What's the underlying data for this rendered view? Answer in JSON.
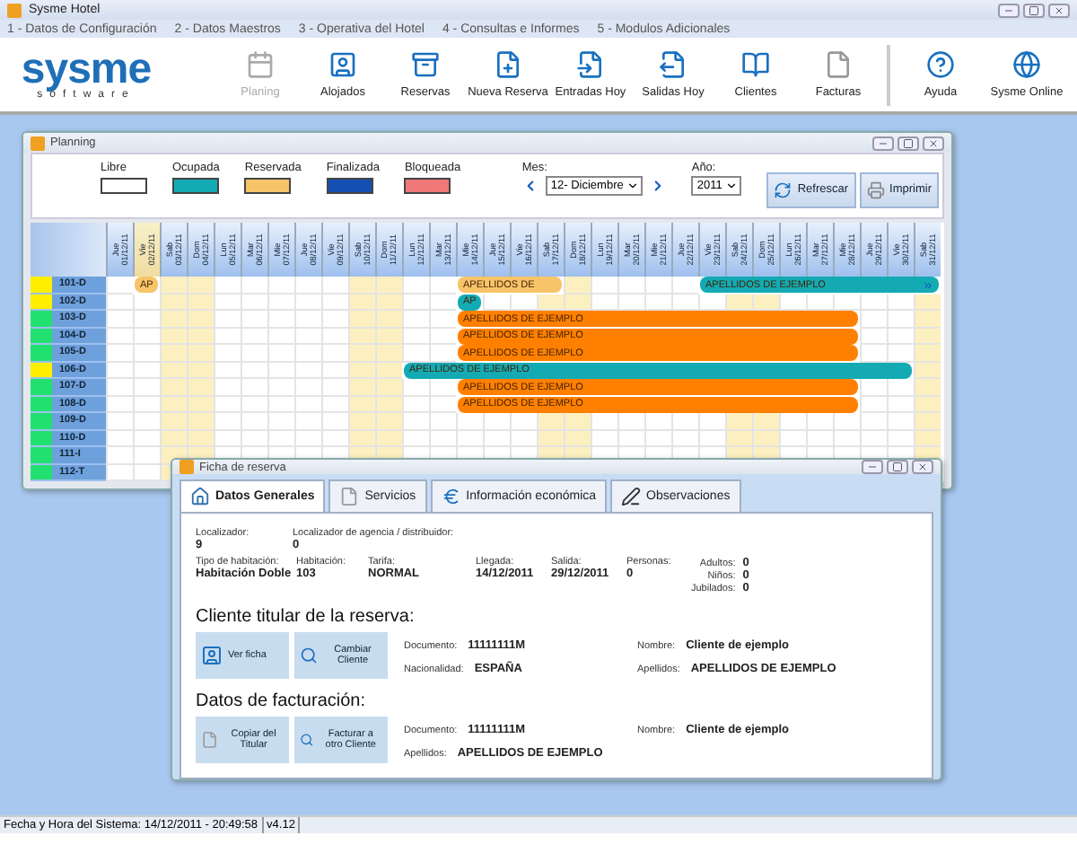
{
  "window": {
    "title": "Sysme Hotel"
  },
  "menu": [
    "1 - Datos de Configuración",
    "2 - Datos Maestros",
    "3 - Operativa del Hotel",
    "4 - Consultas e Informes",
    "5 - Modulos Adicionales"
  ],
  "logo": {
    "name": "sysme",
    "tagline": "software"
  },
  "toolbar": [
    {
      "label": "Planing",
      "kind": "calendar",
      "disabled": true
    },
    {
      "label": "Alojados",
      "kind": "guest",
      "disabled": false
    },
    {
      "label": "Reservas",
      "kind": "cabinet",
      "disabled": false
    },
    {
      "label": "Nueva Reserva",
      "kind": "newdoc",
      "disabled": false
    },
    {
      "label": "Entradas Hoy",
      "kind": "docin",
      "disabled": false
    },
    {
      "label": "Salidas Hoy",
      "kind": "docout",
      "disabled": false
    },
    {
      "label": "Clientes",
      "kind": "book",
      "disabled": false
    },
    {
      "label": "Facturas",
      "kind": "doc",
      "disabled": false
    },
    {
      "label": "Ayuda",
      "kind": "help",
      "disabled": false
    },
    {
      "label": "Sysme Online",
      "kind": "globe",
      "disabled": false
    }
  ],
  "planning": {
    "title": "Planning",
    "legend": [
      {
        "label": "Libre",
        "color": "#ffffff"
      },
      {
        "label": "Ocupada",
        "color": "#14aab4"
      },
      {
        "label": "Reservada",
        "color": "#f8c46a"
      },
      {
        "label": "Finalizada",
        "color": "#1450b4"
      },
      {
        "label": "Bloqueada",
        "color": "#f07878"
      }
    ],
    "month_label": "Mes:",
    "month": "12- Diciembre",
    "year_label": "Año:",
    "year": "2011",
    "buttons": [
      "Refrescar",
      "Imprimir"
    ],
    "days": [
      {
        "day": "Jue",
        "date": "01/12/11",
        "weekend": false,
        "selected": false
      },
      {
        "day": "Vie",
        "date": "02/12/11",
        "weekend": false,
        "selected": true
      },
      {
        "day": "Sab",
        "date": "03/12/11",
        "weekend": true,
        "selected": false
      },
      {
        "day": "Dom",
        "date": "04/12/11",
        "weekend": true,
        "selected": false
      },
      {
        "day": "Lun",
        "date": "05/12/11",
        "weekend": false,
        "selected": false
      },
      {
        "day": "Mar",
        "date": "06/12/11",
        "weekend": false,
        "selected": false
      },
      {
        "day": "Mie",
        "date": "07/12/11",
        "weekend": false,
        "selected": false
      },
      {
        "day": "Jue",
        "date": "08/12/11",
        "weekend": false,
        "selected": false
      },
      {
        "day": "Vie",
        "date": "09/12/11",
        "weekend": false,
        "selected": false
      },
      {
        "day": "Sab",
        "date": "10/12/11",
        "weekend": true,
        "selected": false
      },
      {
        "day": "Dom",
        "date": "11/12/11",
        "weekend": true,
        "selected": false
      },
      {
        "day": "Lun",
        "date": "12/12/11",
        "weekend": false,
        "selected": false
      },
      {
        "day": "Mar",
        "date": "13/12/11",
        "weekend": false,
        "selected": false
      },
      {
        "day": "Mie",
        "date": "14/12/11",
        "weekend": false,
        "selected": false
      },
      {
        "day": "Jue",
        "date": "15/12/11",
        "weekend": false,
        "selected": false
      },
      {
        "day": "Vie",
        "date": "16/12/11",
        "weekend": false,
        "selected": false
      },
      {
        "day": "Sab",
        "date": "17/12/11",
        "weekend": true,
        "selected": false
      },
      {
        "day": "Dom",
        "date": "18/12/11",
        "weekend": true,
        "selected": false
      },
      {
        "day": "Lun",
        "date": "19/12/11",
        "weekend": false,
        "selected": false
      },
      {
        "day": "Mar",
        "date": "20/12/11",
        "weekend": false,
        "selected": false
      },
      {
        "day": "Mie",
        "date": "21/12/11",
        "weekend": false,
        "selected": false
      },
      {
        "day": "Jue",
        "date": "22/12/11",
        "weekend": false,
        "selected": false
      },
      {
        "day": "Vie",
        "date": "23/12/11",
        "weekend": false,
        "selected": false
      },
      {
        "day": "Sab",
        "date": "24/12/11",
        "weekend": true,
        "selected": false
      },
      {
        "day": "Dom",
        "date": "25/12/11",
        "weekend": true,
        "selected": false
      },
      {
        "day": "Lun",
        "date": "26/12/11",
        "weekend": false,
        "selected": false
      },
      {
        "day": "Mar",
        "date": "27/12/11",
        "weekend": false,
        "selected": false
      },
      {
        "day": "Mie",
        "date": "28/12/11",
        "weekend": false,
        "selected": false
      },
      {
        "day": "Jue",
        "date": "29/12/11",
        "weekend": false,
        "selected": false
      },
      {
        "day": "Vie",
        "date": "30/12/11",
        "weekend": false,
        "selected": false
      },
      {
        "day": "Sab",
        "date": "31/12/11",
        "weekend": true,
        "selected": false
      }
    ],
    "rooms": [
      {
        "name": "101-D",
        "color": "#ffee00",
        "cells": [
          {
            "kind": "free"
          },
          {
            "kind": "booking",
            "label": "AP",
            "color": "#f8c46a"
          },
          {
            "kind": "free"
          },
          {
            "kind": "free"
          },
          {
            "kind": "free"
          },
          {
            "kind": "free"
          },
          {
            "kind": "free"
          },
          {
            "kind": "free"
          },
          {
            "kind": "free"
          },
          {
            "kind": "free"
          },
          {
            "kind": "free"
          },
          {
            "kind": "free"
          },
          {
            "kind": "free"
          },
          {
            "kind": "booking",
            "label": "APELLIDOS DE",
            "color": "#f8c46a"
          },
          {
            "kind": "stay"
          },
          {
            "kind": "stay"
          },
          {
            "kind": "stay"
          },
          {
            "kind": "free"
          },
          {
            "kind": "free"
          },
          {
            "kind": "free"
          },
          {
            "kind": "free"
          },
          {
            "kind": "free"
          },
          {
            "kind": "booking",
            "label": "APELLIDOS DE EJEMPLO",
            "color": "#14aab4",
            "continues": true
          },
          {
            "kind": "stay"
          },
          {
            "kind": "stay"
          },
          {
            "kind": "stay"
          },
          {
            "kind": "stay"
          },
          {
            "kind": "stay"
          },
          {
            "kind": "stay"
          },
          {
            "kind": "stay"
          },
          {
            "kind": "stay"
          }
        ]
      },
      {
        "name": "102-D",
        "color": "#ffee00",
        "cells": [
          {
            "kind": "free"
          },
          {
            "kind": "free"
          },
          {
            "kind": "free"
          },
          {
            "kind": "free"
          },
          {
            "kind": "free"
          },
          {
            "kind": "free"
          },
          {
            "kind": "free"
          },
          {
            "kind": "free"
          },
          {
            "kind": "free"
          },
          {
            "kind": "free"
          },
          {
            "kind": "free"
          },
          {
            "kind": "free"
          },
          {
            "kind": "free"
          },
          {
            "kind": "booking",
            "label": "AP",
            "color": "#14aab4"
          }
        ]
      },
      {
        "name": "103-D",
        "color": "#22e070",
        "cells": [
          {
            "kind": "free"
          },
          {
            "kind": "free"
          },
          {
            "kind": "free"
          },
          {
            "kind": "free"
          },
          {
            "kind": "free"
          },
          {
            "kind": "free"
          },
          {
            "kind": "free"
          },
          {
            "kind": "free"
          },
          {
            "kind": "free"
          },
          {
            "kind": "free"
          },
          {
            "kind": "free"
          },
          {
            "kind": "free"
          },
          {
            "kind": "free"
          },
          {
            "kind": "booking",
            "label": "APELLIDOS DE EJEMPLO",
            "color": "#ff8000"
          },
          {
            "kind": "stay"
          },
          {
            "kind": "stay"
          },
          {
            "kind": "stay"
          },
          {
            "kind": "stay"
          },
          {
            "kind": "stay"
          },
          {
            "kind": "stay"
          },
          {
            "kind": "stay"
          },
          {
            "kind": "stay"
          },
          {
            "kind": "stay"
          },
          {
            "kind": "stay"
          },
          {
            "kind": "stay"
          },
          {
            "kind": "stay"
          },
          {
            "kind": "stay"
          },
          {
            "kind": "stay"
          }
        ]
      },
      {
        "name": "104-D",
        "color": "#22e070",
        "cells": [
          {
            "kind": "free"
          },
          {
            "kind": "free"
          },
          {
            "kind": "free"
          },
          {
            "kind": "free"
          },
          {
            "kind": "free"
          },
          {
            "kind": "free"
          },
          {
            "kind": "free"
          },
          {
            "kind": "free"
          },
          {
            "kind": "free"
          },
          {
            "kind": "free"
          },
          {
            "kind": "free"
          },
          {
            "kind": "free"
          },
          {
            "kind": "free"
          },
          {
            "kind": "booking",
            "label": "APELLIDOS DE EJEMPLO",
            "color": "#ff8000"
          },
          {
            "kind": "stay"
          },
          {
            "kind": "stay"
          },
          {
            "kind": "stay"
          },
          {
            "kind": "stay"
          },
          {
            "kind": "stay"
          },
          {
            "kind": "stay"
          },
          {
            "kind": "stay"
          },
          {
            "kind": "stay"
          },
          {
            "kind": "stay"
          },
          {
            "kind": "stay"
          },
          {
            "kind": "stay"
          },
          {
            "kind": "stay"
          },
          {
            "kind": "stay"
          },
          {
            "kind": "stay"
          }
        ]
      },
      {
        "name": "105-D",
        "color": "#22e070",
        "cells": [
          {
            "kind": "free"
          },
          {
            "kind": "free"
          },
          {
            "kind": "free"
          },
          {
            "kind": "free"
          },
          {
            "kind": "free"
          },
          {
            "kind": "free"
          },
          {
            "kind": "free"
          },
          {
            "kind": "free"
          },
          {
            "kind": "free"
          },
          {
            "kind": "free"
          },
          {
            "kind": "free"
          },
          {
            "kind": "free"
          },
          {
            "kind": "free"
          },
          {
            "kind": "booking",
            "label": "APELLIDOS DE EJEMPLO",
            "color": "#ff8000"
          },
          {
            "kind": "stay"
          },
          {
            "kind": "stay"
          },
          {
            "kind": "stay"
          },
          {
            "kind": "stay"
          },
          {
            "kind": "stay"
          },
          {
            "kind": "stay"
          },
          {
            "kind": "stay"
          },
          {
            "kind": "stay"
          },
          {
            "kind": "stay"
          },
          {
            "kind": "stay"
          },
          {
            "kind": "stay"
          },
          {
            "kind": "stay"
          },
          {
            "kind": "stay"
          },
          {
            "kind": "stay"
          }
        ]
      },
      {
        "name": "106-D",
        "color": "#ffee00",
        "cells": [
          {
            "kind": "free"
          },
          {
            "kind": "free"
          },
          {
            "kind": "free"
          },
          {
            "kind": "free"
          },
          {
            "kind": "free"
          },
          {
            "kind": "free"
          },
          {
            "kind": "free"
          },
          {
            "kind": "free"
          },
          {
            "kind": "free"
          },
          {
            "kind": "free"
          },
          {
            "kind": "free"
          },
          {
            "kind": "booking",
            "label": "APELLIDOS DE EJEMPLO",
            "color": "#14aab4"
          },
          {
            "kind": "stay"
          },
          {
            "kind": "stay"
          },
          {
            "kind": "stay"
          },
          {
            "kind": "stay"
          },
          {
            "kind": "stay"
          },
          {
            "kind": "stay"
          },
          {
            "kind": "stay"
          },
          {
            "kind": "stay"
          },
          {
            "kind": "stay"
          },
          {
            "kind": "stay"
          },
          {
            "kind": "stay"
          },
          {
            "kind": "stay"
          },
          {
            "kind": "stay"
          },
          {
            "kind": "stay"
          },
          {
            "kind": "stay"
          },
          {
            "kind": "stay"
          },
          {
            "kind": "stay"
          },
          {
            "kind": "stay"
          }
        ]
      },
      {
        "name": "107-D",
        "color": "#22e070",
        "cells": [
          {
            "kind": "free"
          },
          {
            "kind": "free"
          },
          {
            "kind": "free"
          },
          {
            "kind": "free"
          },
          {
            "kind": "free"
          },
          {
            "kind": "free"
          },
          {
            "kind": "free"
          },
          {
            "kind": "free"
          },
          {
            "kind": "free"
          },
          {
            "kind": "free"
          },
          {
            "kind": "free"
          },
          {
            "kind": "free"
          },
          {
            "kind": "free"
          },
          {
            "kind": "booking",
            "label": "APELLIDOS DE EJEMPLO",
            "color": "#ff8000"
          },
          {
            "kind": "stay"
          },
          {
            "kind": "stay"
          },
          {
            "kind": "stay"
          },
          {
            "kind": "stay"
          },
          {
            "kind": "stay"
          },
          {
            "kind": "stay"
          },
          {
            "kind": "stay"
          },
          {
            "kind": "stay"
          },
          {
            "kind": "stay"
          },
          {
            "kind": "stay"
          },
          {
            "kind": "stay"
          },
          {
            "kind": "stay"
          },
          {
            "kind": "stay"
          },
          {
            "kind": "stay"
          }
        ]
      },
      {
        "name": "108-D",
        "color": "#22e070",
        "cells": [
          {
            "kind": "free"
          },
          {
            "kind": "free"
          },
          {
            "kind": "free"
          },
          {
            "kind": "free"
          },
          {
            "kind": "free"
          },
          {
            "kind": "free"
          },
          {
            "kind": "free"
          },
          {
            "kind": "free"
          },
          {
            "kind": "free"
          },
          {
            "kind": "free"
          },
          {
            "kind": "free"
          },
          {
            "kind": "free"
          },
          {
            "kind": "free"
          },
          {
            "kind": "booking",
            "label": "APELLIDOS DE EJEMPLO",
            "color": "#ff8000"
          },
          {
            "kind": "stay"
          },
          {
            "kind": "stay"
          },
          {
            "kind": "stay"
          },
          {
            "kind": "stay"
          },
          {
            "kind": "stay"
          },
          {
            "kind": "stay"
          },
          {
            "kind": "stay"
          },
          {
            "kind": "stay"
          },
          {
            "kind": "stay"
          },
          {
            "kind": "stay"
          },
          {
            "kind": "stay"
          },
          {
            "kind": "stay"
          },
          {
            "kind": "stay"
          },
          {
            "kind": "stay"
          }
        ]
      },
      {
        "name": "109-D",
        "color": "#22e070"
      },
      {
        "name": "110-D",
        "color": "#22e070"
      },
      {
        "name": "111-I",
        "color": "#22e070"
      },
      {
        "name": "112-T",
        "color": "#22e070"
      }
    ]
  },
  "booking": {
    "title": "Ficha de reserva",
    "tabs": [
      {
        "label": "Datos Generales",
        "kind": "home",
        "selected": true
      },
      {
        "label": "Servicios",
        "kind": "doc",
        "selected": false
      },
      {
        "label": "Información económica",
        "kind": "euro",
        "selected": false
      },
      {
        "label": "Observaciones",
        "kind": "note",
        "selected": false
      }
    ],
    "top_fields": [
      {
        "label": "Localizador:",
        "value": "9"
      },
      {
        "label": "Localizador de agencia / distribuidor:",
        "value": "0"
      }
    ],
    "stay_fields": [
      {
        "label": "Tipo de habitación:",
        "value": "Habitación Doble"
      },
      {
        "label": "Habitación:",
        "value": "103"
      },
      {
        "label": "Tarifa:",
        "value": "NORMAL"
      },
      {
        "label": "Llegada:",
        "value": "14/12/2011"
      },
      {
        "label": "Salida:",
        "value": "29/12/2011"
      },
      {
        "label": "Personas:",
        "value": "0"
      }
    ],
    "guests": [
      {
        "label": "Adultos:",
        "value": "0"
      },
      {
        "label": "Niños:",
        "value": "0"
      },
      {
        "label": "Jubilados:",
        "value": "0"
      }
    ],
    "sections": [
      {
        "title": "Cliente titular de la reserva:",
        "buttons": [
          {
            "label": "Ver ficha",
            "kind": "guest"
          },
          {
            "label": "Cambiar Cliente",
            "kind": "search"
          }
        ],
        "fields": [
          {
            "label": "Documento:",
            "value": "11111111M"
          },
          {
            "label": "Nombre:",
            "value": "Cliente de ejemplo"
          },
          {
            "label": "Nacionalidad:",
            "value": "ESPAÑA"
          },
          {
            "label": "Apellidos:",
            "value": "APELLIDOS DE EJEMPLO"
          }
        ]
      },
      {
        "title": "Datos de facturación:",
        "buttons": [
          {
            "label": "Copiar del Titular",
            "kind": "doc"
          },
          {
            "label": "Facturar a otro Cliente",
            "kind": "search"
          }
        ],
        "fields": [
          {
            "label": "Documento:",
            "value": "11111111M"
          },
          {
            "label": "Nombre:",
            "value": "Cliente de ejemplo"
          },
          {
            "label": "Apellidos:",
            "value": "APELLIDOS DE EJEMPLO"
          }
        ]
      }
    ]
  },
  "status_bar": {
    "datetime": "Fecha y Hora del Sistema: 14/12/2011 - 20:49:58",
    "version": "v4.12"
  }
}
